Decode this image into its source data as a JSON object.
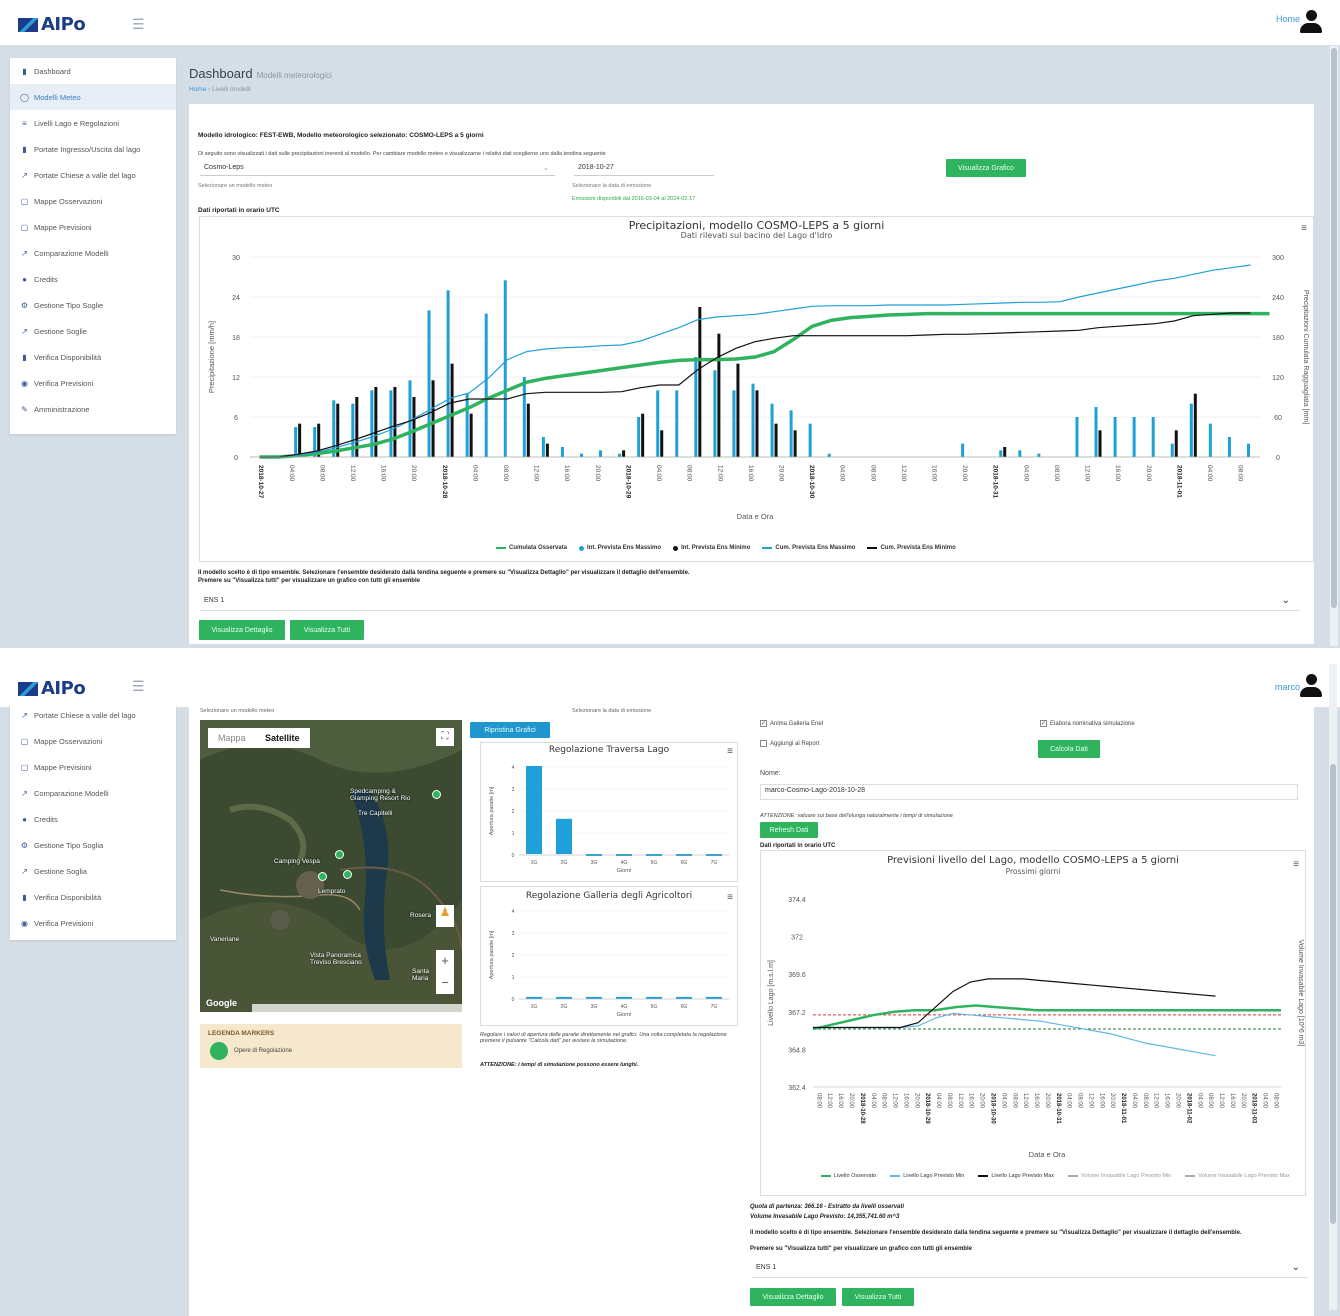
{
  "app": {
    "logo": "AIPo",
    "user_top": "Home",
    "user_bottom": "marco"
  },
  "sidebar_top": [
    {
      "icon": "▮",
      "label": "Dashboard"
    },
    {
      "icon": "◯",
      "label": "Modelli Meteo"
    },
    {
      "icon": "≡",
      "label": "Livelli Lago e Regolazioni"
    },
    {
      "icon": "▮",
      "label": "Portate Ingresso/Uscita dal lago"
    },
    {
      "icon": "↗",
      "label": "Portate Chiese a valle del lago"
    },
    {
      "icon": "▢",
      "label": "Mappe Osservazioni"
    },
    {
      "icon": "▢",
      "label": "Mappe Previsioni"
    },
    {
      "icon": "↗",
      "label": "Comparazione Modelli"
    },
    {
      "icon": "●",
      "label": "Credits"
    },
    {
      "icon": "⚙",
      "label": "Gestione Tipo Soglie"
    },
    {
      "icon": "↗",
      "label": "Gestione Soglie"
    },
    {
      "icon": "▮",
      "label": "Verifica Disponibilità"
    },
    {
      "icon": "◉",
      "label": "Verifica Previsioni"
    },
    {
      "icon": "✎",
      "label": "Amministrazione"
    }
  ],
  "sidebar_bottom": [
    {
      "icon": "↗",
      "label": "Portate Chiese a valle del lago"
    },
    {
      "icon": "▢",
      "label": "Mappe Osservazioni"
    },
    {
      "icon": "▢",
      "label": "Mappe Previsioni"
    },
    {
      "icon": "↗",
      "label": "Comparazione Modelli"
    },
    {
      "icon": "●",
      "label": "Credits"
    },
    {
      "icon": "⚙",
      "label": "Gestione Tipo Soglia"
    },
    {
      "icon": "↗",
      "label": "Gestione Soglia"
    },
    {
      "icon": "▮",
      "label": "Verifica Disponibilità"
    },
    {
      "icon": "◉",
      "label": "Verifica Previsioni"
    }
  ],
  "top": {
    "page_title": "Dashboard",
    "page_subtitle": "Modelli meteorologici",
    "breadcrumb_home": "Home",
    "breadcrumb_current": "Livelli modelli",
    "model_line": "Modello idrologico: FEST-EWB, Modello meteorologico selezionato: COSMO-LEPS a 5 giorni",
    "intro": "Di seguito sono visualizzati i dati sulle precipitazioni inerenti al modello. Per cambiare modello meteo e visualizzarne i relativi dati sceglierne uno dalla tendina seguente",
    "model_select": "Cosmo-Leps",
    "model_select_help": "Selezionare un modello meteo",
    "date_select": "2018-10-27",
    "date_select_help": "Selezionare la data di emissione",
    "emissions": "Emissioni disponibili dal 2016-03-04 al 2024-02-17",
    "btn_chart": "Visualizza Grafico",
    "utc_note": "Dati riportati in orario UTC",
    "ensemble_note": "Il modello scelto è di tipo ensemble. Selezionare l'ensemble desiderato dalla tendina seguente e premere su \"Visualizza Dettaglio\" per visualizzare il dettaglio dell'ensemble.",
    "ensemble_note2": "Premere su \"Visualizza tutti\" per visualizzare un grafico con tutti gli ensemble",
    "ens_select": "ENS 1",
    "btn_detail": "Visualizza Dettaglio",
    "btn_all": "Visualizza Tutti"
  },
  "chart_data": [
    {
      "type": "bar",
      "title": "Precipitazioni, modello COSMO-LEPS a 5 giorni",
      "subtitle": "Dati rilevati sul bacino del Lago d'Idro",
      "xlabel": "Data e Ora",
      "ylabel": "Precipitazione [mm/h]",
      "y2label": "Precipitazioni Cumulata Ragguagliata [mm]",
      "ylim": [
        0,
        30
      ],
      "y2lim": [
        0,
        300
      ],
      "yticks": [
        "0",
        "6",
        "12",
        "18",
        "24",
        "30"
      ],
      "y2ticks": [
        "0",
        "60",
        "120",
        "180",
        "240",
        "300"
      ],
      "xticks": [
        "2018-10-27",
        "04:00",
        "08:00",
        "12:00",
        "16:00",
        "20:00",
        "2018-10-28",
        "04:00",
        "08:00",
        "12:00",
        "16:00",
        "20:00",
        "2018-10-29",
        "04:00",
        "08:00",
        "12:00",
        "16:00",
        "20:00",
        "2018-10-30",
        "04:00",
        "08:00",
        "12:00",
        "16:00",
        "20:00",
        "2018-10-31",
        "04:00",
        "08:00",
        "12:00",
        "16:00",
        "20:00",
        "2018-11-01",
        "04:00",
        "08:00"
      ],
      "series": [
        {
          "name": "Cumulata Osservata",
          "color": "#2fb35f",
          "values": [
            0,
            0,
            2,
            5,
            9,
            14,
            19,
            27,
            38,
            50,
            62,
            74,
            88,
            100,
            112,
            118,
            122,
            126,
            130,
            134,
            138,
            142,
            145,
            146,
            146,
            147,
            150,
            158,
            176,
            196,
            205,
            209,
            211,
            213,
            214,
            215,
            215,
            215,
            215,
            215,
            215,
            215,
            215,
            215,
            215,
            215,
            215,
            215,
            215,
            215,
            215,
            215,
            215,
            215
          ]
        },
        {
          "name": "Int. Prevista Ens Massimo",
          "color": "#1fa0d8",
          "values": [
            0,
            0,
            4.5,
            4.5,
            8.5,
            8,
            10,
            10,
            11.5,
            22,
            25,
            9.5,
            21.5,
            26.5,
            12,
            3,
            1.5,
            0.5,
            1,
            0.5,
            6,
            10,
            10,
            15,
            13,
            10,
            11,
            8,
            7,
            5,
            0.5,
            0,
            0,
            0,
            0,
            0,
            0,
            2,
            0,
            1,
            1,
            0.5,
            0,
            6,
            7.5,
            6,
            6,
            6,
            2,
            8,
            5,
            3,
            2
          ]
        },
        {
          "name": "Int. Prevista Ens Minimo",
          "color": "#111111",
          "values": [
            0,
            0,
            5,
            5,
            8,
            9,
            10.5,
            10.5,
            9,
            11.5,
            14,
            6.5,
            0,
            0,
            8,
            2,
            0,
            0,
            0,
            1,
            6.5,
            4,
            0,
            22.5,
            18.5,
            14,
            10,
            5,
            4,
            0,
            0,
            0,
            0,
            0,
            0,
            0,
            0,
            0,
            0,
            1.5,
            0,
            0,
            0,
            0,
            4,
            0,
            0,
            0,
            4,
            9.5,
            0,
            0,
            0
          ]
        },
        {
          "name": "Cum. Prevista Ens Massimo",
          "color": "#1fa0d8",
          "values": [
            0,
            0,
            3,
            7,
            14,
            22,
            31,
            42,
            56,
            72,
            88,
            96,
            118,
            146,
            158,
            162,
            164,
            165,
            167,
            168,
            174,
            184,
            194,
            206,
            210,
            212,
            214,
            218,
            222,
            226,
            227,
            227,
            227,
            228,
            228,
            228,
            228,
            229,
            230,
            231,
            232,
            232,
            233,
            240,
            246,
            252,
            258,
            264,
            268,
            274,
            280,
            284,
            288
          ]
        },
        {
          "name": "Cum. Prevista Ens Minimo",
          "color": "#111111",
          "values": [
            0,
            0,
            4,
            9,
            17,
            26,
            36,
            46,
            55,
            67,
            81,
            87,
            87,
            87,
            95,
            97,
            97,
            97,
            97,
            98,
            104,
            108,
            108,
            131,
            149,
            163,
            173,
            178,
            182,
            182,
            182,
            182,
            182,
            182,
            182,
            183,
            184,
            184,
            185,
            186,
            187,
            188,
            189,
            190,
            194,
            196,
            198,
            200,
            204,
            212,
            214,
            216,
            216
          ]
        }
      ]
    },
    {
      "type": "bar",
      "title": "Regolazione Traversa Lago",
      "xlabel": "Giorni",
      "ylabel": "Apertura paratie [m]",
      "categories": [
        "1G",
        "2G",
        "3G",
        "4G",
        "5G",
        "6G",
        "7G"
      ],
      "yticks": [
        "0",
        "1",
        "2",
        "3",
        "4"
      ],
      "ylim": [
        0,
        4
      ],
      "values": [
        4,
        1.6,
        0,
        0,
        0,
        0,
        0
      ]
    },
    {
      "type": "bar",
      "title": "Regolazione Galleria degli Agricoltori",
      "xlabel": "Giorni",
      "ylabel": "Apertura paratie [m]",
      "categories": [
        "1G",
        "2G",
        "3G",
        "4G",
        "5G",
        "6G",
        "7G"
      ],
      "yticks": [
        "0",
        "1",
        "2",
        "3",
        "4"
      ],
      "ylim": [
        0,
        4
      ],
      "values": [
        0.05,
        0.05,
        0.05,
        0.05,
        0.05,
        0.05,
        0.05
      ]
    },
    {
      "type": "line",
      "title": "Previsioni livello del Lago, modello COSMO-LEPS a 5 giorni",
      "subtitle": "Prossimi giorni",
      "xlabel": "Data e Ora",
      "ylabel": "Livello Lago [m.s.l.m]",
      "y2label": "Volume Invasabile Lago [10^6 m3]",
      "yticks": [
        "362.4",
        "364.8",
        "367.2",
        "369.6",
        "372",
        "374.4"
      ],
      "ylim": [
        362.4,
        374.4
      ],
      "series": [
        {
          "name": "Livello Osservato",
          "color": "#2fb35f",
          "values": [
            366.1,
            366.4,
            366.7,
            367.0,
            367.2,
            367.3,
            367.3,
            367.5,
            367.6,
            367.5,
            367.4,
            367.3,
            367.3,
            367.3,
            367.3,
            367.3,
            367.3,
            367.3,
            367.3,
            367.3,
            367.3,
            367.3,
            367.3,
            367.3
          ]
        },
        {
          "name": "Livello Lago Previsto Min",
          "color": "#5fb9e6",
          "values": [
            366.2,
            366.2,
            366.2,
            366.2,
            366.2,
            366.2,
            366.3,
            366.8,
            367.1,
            367.0,
            366.9,
            366.8,
            366.7,
            366.6,
            366.4,
            366.2,
            366.0,
            365.8,
            365.5,
            365.2,
            365.0,
            364.8,
            364.6,
            364.4
          ]
        },
        {
          "name": "Livello Lago Previsto Max",
          "color": "#111111",
          "values": [
            366.2,
            366.2,
            366.2,
            366.2,
            366.2,
            366.2,
            366.5,
            367.5,
            368.5,
            369.1,
            369.3,
            369.3,
            369.3,
            369.2,
            369.1,
            369.0,
            368.9,
            368.8,
            368.7,
            368.6,
            368.5,
            368.4,
            368.3,
            368.2
          ]
        },
        {
          "name": "Volume Invasabile Lago Previsto Min",
          "color": "#aaaaaa",
          "values": []
        },
        {
          "name": "Volume Invasabile Lago Previsto Max",
          "color": "#aaaaaa",
          "values": []
        }
      ],
      "thresholds": [
        {
          "color": "#e03030",
          "value": 367.0
        },
        {
          "color": "#2a7a3a",
          "value": 366.1
        }
      ],
      "xticks": [
        "08:00",
        "12:00",
        "16:00",
        "20:00",
        "2018-10-28",
        "04:00",
        "08:00",
        "12:00",
        "16:00",
        "20:00",
        "2018-10-29",
        "04:00",
        "08:00",
        "12:00",
        "16:00",
        "20:00",
        "2018-10-30",
        "04:00",
        "08:00",
        "12:00",
        "16:00",
        "20:00",
        "2018-10-31",
        "04:00",
        "08:00",
        "12:00",
        "16:00",
        "20:00",
        "2018-11-01",
        "04:00",
        "08:00",
        "12:00",
        "16:00",
        "20:00",
        "2018-11-02",
        "04:00",
        "08:00",
        "12:00",
        "16:00",
        "20:00",
        "2018-11-03",
        "04:00",
        "08:00"
      ]
    }
  ],
  "bottom": {
    "model_help": "Selezionare un modello meteo",
    "date_help": "Selezionare la data di emissione",
    "map_tab_map": "Mappa",
    "map_tab_sat": "Satellite",
    "map_labels": [
      "Spedcamping &\nGlamping Resort Rio",
      "Tre Capitelli",
      "Camping Vespa",
      "Lemprato",
      "Vista Panoramica\nTreviso Bresciano",
      "Rosera",
      "Vaneriane",
      "Santa\nMaria"
    ],
    "google": "Google",
    "legend_title": "LEGENDA MARKERS",
    "legend_item": "Opere di Regolazione",
    "btn_regolazione": "Ripristina Grafici",
    "note_regolazione": "Regolare i valori di apertura delle paratie direttamente nei grafici. Una volta completata la regolazione premere il pulsante \"Calcola dati\" per avviare la simulazione.",
    "note_attenzione": "ATTENZIONE: i tempi di simulazione possono essere lunghi.",
    "chk_galleria": "Anima Galleria Enel",
    "chk_report": "Aggiungi al Report",
    "chk_simulazione": "Elabora nominativa simulazione",
    "btn_calcola": "Calcola Dati",
    "name_label": "Nome:",
    "name_value": "marco-Cosmo-Lago-2018-10-28",
    "attenzione": "ATTENZIONE: valuare sui base dell'eluriga naturalmente i tempi di simulazione",
    "btn_refresh": "Refresh Dati",
    "utc_note": "Dati riportati in orario UTC",
    "quota": "Quota di partenza: 366.16 - Estratto da livelli osservati",
    "volume": "Volume Invasabile Lago Previsto: 14,355,741.60 m^3",
    "ensemble_note": "Il modello scelto è di tipo ensemble. Selezionare l'ensemble desiderato dalla tendina seguente e premere su \"Visualizza Dettaglio\" per visualizzare il dettaglio dell'ensemble.",
    "ensemble_note2": "Premere su \"Visualizza tutti\" per visualizzare un grafico con tutti gli ensemble",
    "ens_select": "ENS 1",
    "btn_detail": "Visualizza Dettaglio",
    "btn_all": "Visualizza Tutti"
  }
}
